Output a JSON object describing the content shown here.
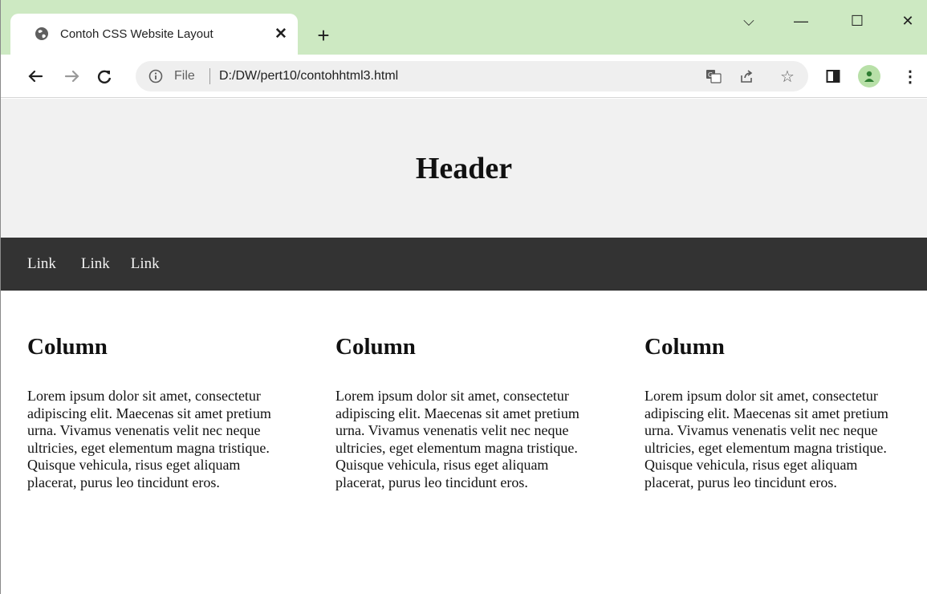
{
  "browser": {
    "tab": {
      "title": "Contoh CSS Website Layout",
      "close_glyph": "✕"
    },
    "new_tab_glyph": "+",
    "window_controls": {
      "tab_search": "⌵",
      "minimize": "—",
      "maximize": "☐",
      "close": "✕"
    },
    "address_bar": {
      "scheme_label": "File",
      "url": "D:/DW/pert10/contohhtml3.html"
    },
    "star_glyph": "☆",
    "menu_glyph": "⋮",
    "accent_color": "#cde9c2"
  },
  "page": {
    "header": {
      "title": "Header"
    },
    "nav": {
      "links": [
        "Link",
        "Link",
        "Link"
      ]
    },
    "columns": [
      {
        "heading": "Column",
        "text": "Lorem ipsum dolor sit amet, consectetur adipiscing elit. Maecenas sit amet pretium urna. Vivamus venenatis velit nec neque ultricies, eget elementum magna tristique. Quisque vehicula, risus eget aliquam placerat, purus leo tincidunt eros."
      },
      {
        "heading": "Column",
        "text": "Lorem ipsum dolor sit amet, consectetur adipiscing elit. Maecenas sit amet pretium urna. Vivamus venenatis velit nec neque ultricies, eget elementum magna tristique. Quisque vehicula, risus eget aliquam placerat, purus leo tincidunt eros."
      },
      {
        "heading": "Column",
        "text": "Lorem ipsum dolor sit amet, consectetur adipiscing elit. Maecenas sit amet pretium urna. Vivamus venenatis velit nec neque ultricies, eget elementum magna tristique. Quisque vehicula, risus eget aliquam placerat, purus leo tincidunt eros."
      }
    ],
    "colors": {
      "header_bg": "#f1f1f1",
      "nav_bg": "#333333",
      "nav_text": "#f2f2f2"
    }
  }
}
